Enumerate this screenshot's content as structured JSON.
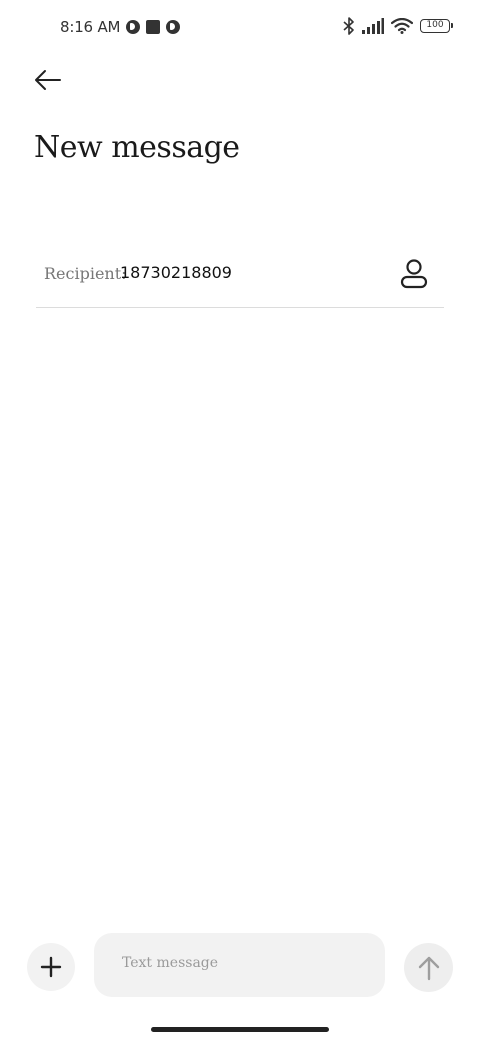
{
  "status_bar": {
    "time": "8:16 AM",
    "battery": "100",
    "icons_left": [
      "app-notification-icon",
      "stop-square-icon",
      "app-notification-icon"
    ],
    "icons_right": [
      "bluetooth-icon",
      "cellular-signal-icon",
      "wifi-icon",
      "battery-icon"
    ]
  },
  "header": {
    "back_icon": "back-arrow-icon",
    "title": "New message"
  },
  "recipient": {
    "label": "Recipient:",
    "value": "18730218809",
    "contact_icon": "contact-person-icon"
  },
  "compose": {
    "add_icon": "plus-icon",
    "placeholder": "Text message",
    "send_icon": "send-arrow-up-icon"
  },
  "colors": {
    "background": "#ffffff",
    "field_background": "#f2f2f2",
    "divider": "#dcdcdc",
    "text_primary": "#1a1a1a",
    "text_secondary": "#777777",
    "send_disabled": "#9e9e9e"
  }
}
